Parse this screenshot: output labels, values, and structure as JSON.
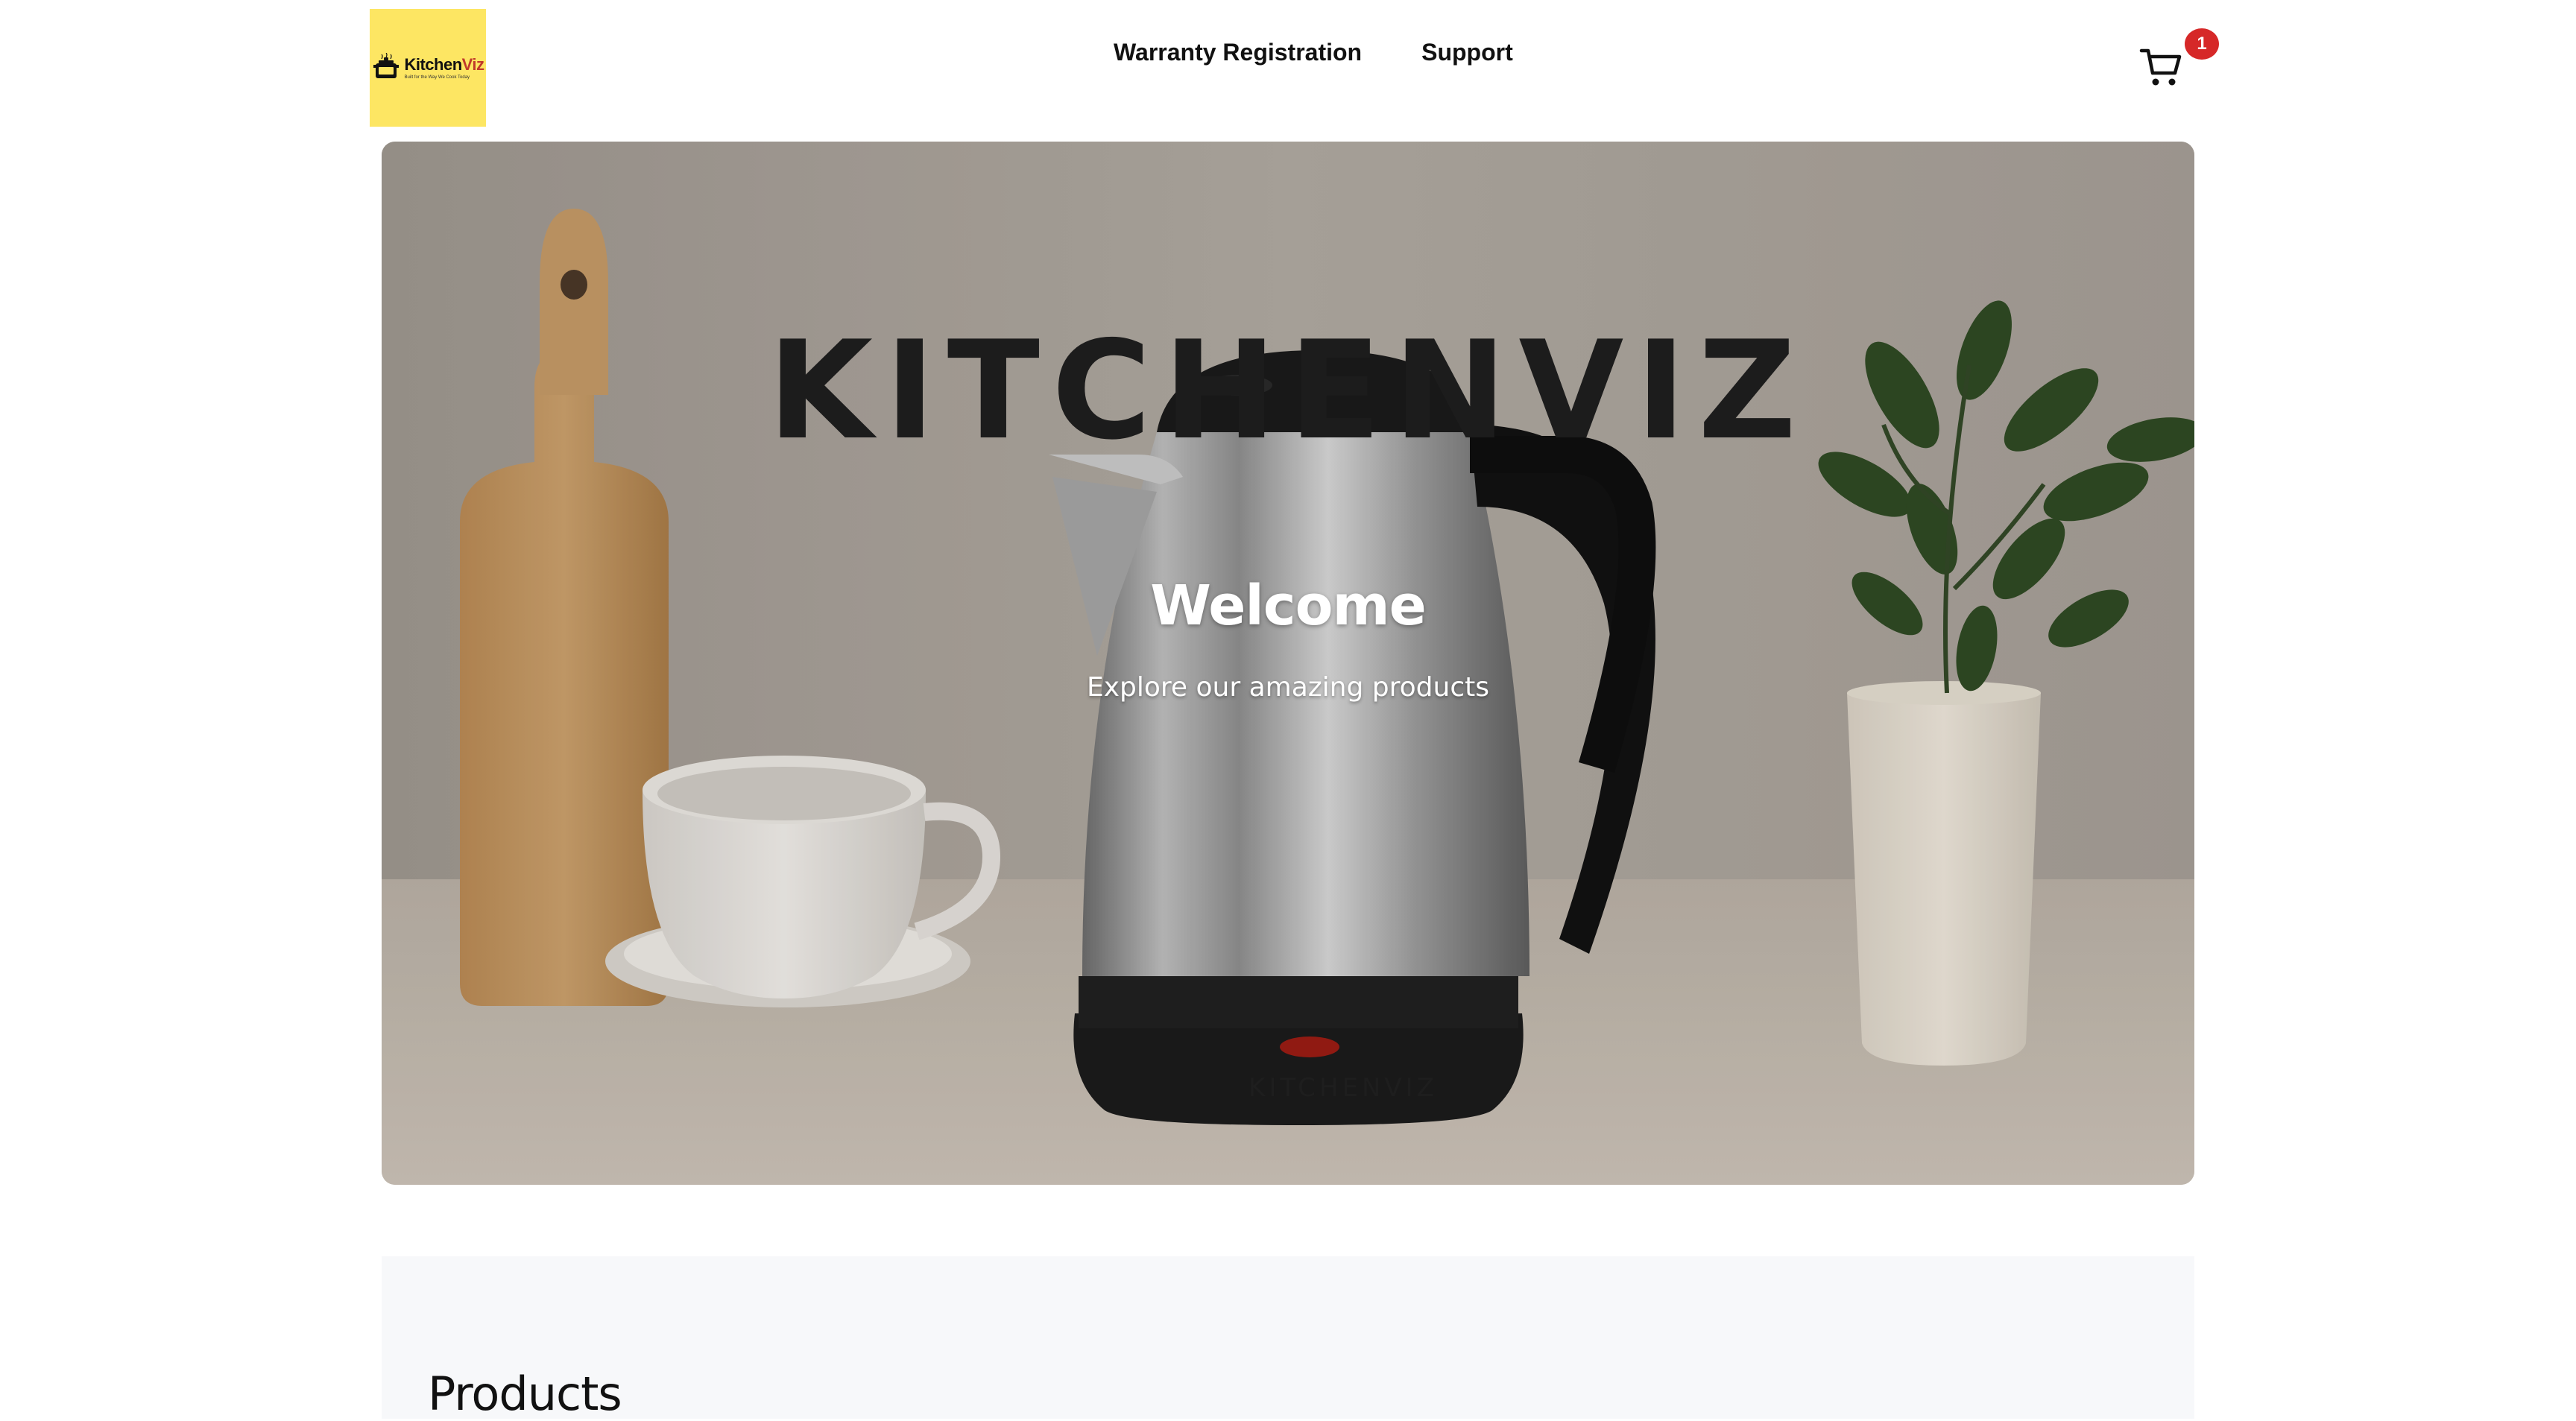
{
  "header": {
    "logo": {
      "word_main": "Kitchen",
      "word_accent": "Viz",
      "tagline": "Built for the Way We Cook Today",
      "background_color": "#fde663",
      "icon": "cooking-pot-icon"
    },
    "nav": {
      "items": [
        {
          "label": "Warranty Registration"
        },
        {
          "label": "Support"
        }
      ]
    },
    "cart": {
      "icon": "cart-icon",
      "count": "1",
      "badge_color": "#d62828"
    }
  },
  "hero": {
    "brand_text": "KITCHENVIZ",
    "kettle_label": "KITCHENVIZ",
    "title": "Welcome",
    "subtitle": "Explore our amazing products"
  },
  "products": {
    "heading": "Products"
  }
}
